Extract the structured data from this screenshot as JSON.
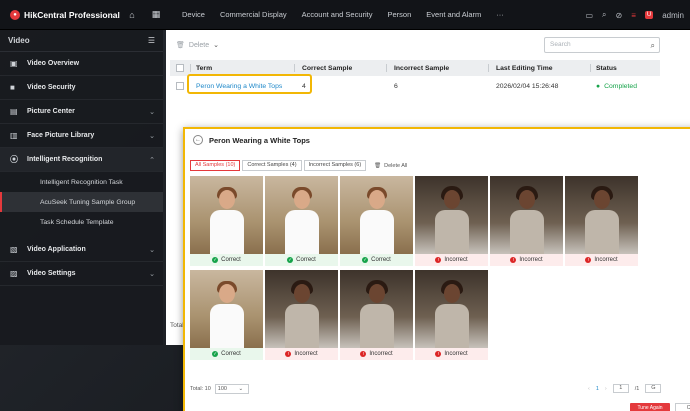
{
  "app": {
    "title": "HikCentral Professional",
    "user": "admin"
  },
  "menu": [
    "Device",
    "Commercial Display",
    "Account and Security",
    "Person",
    "Event and Alarm",
    "···"
  ],
  "sidebar": {
    "section": "Video",
    "items": [
      {
        "label": "Video Overview"
      },
      {
        "label": "Video Security"
      },
      {
        "label": "Picture Center"
      },
      {
        "label": "Face Picture Library"
      },
      {
        "label": "Intelligent Recognition"
      },
      {
        "label": "Video Application"
      },
      {
        "label": "Video Settings"
      }
    ],
    "subitems": [
      "Intelligent Recognition Task",
      "AcuSeek Tuning Sample Group",
      "Task Schedule Template"
    ]
  },
  "main": {
    "delete_label": "Delete",
    "search_placeholder": "Search",
    "columns": [
      "Term",
      "Correct Sample",
      "Incorrect Sample",
      "Last Editing Time",
      "Status"
    ],
    "row": {
      "term": "Peron Wearing a White Tops",
      "correct": "4",
      "incorrect": "6",
      "time": "2026/02/04 15:26:48",
      "status": "Completed"
    },
    "total_label": "Total"
  },
  "dialog": {
    "title": "Peron Wearing a White Tops",
    "tabs": [
      "All Samples (10)",
      "Correct Samples (4)",
      "Incorrect Samples (6)"
    ],
    "delete_all": "Delete All",
    "cards": [
      {
        "label": "Correct"
      },
      {
        "label": "Correct"
      },
      {
        "label": "Correct"
      },
      {
        "label": "Incorrect"
      },
      {
        "label": "Incorrect"
      },
      {
        "label": "Incorrect"
      },
      {
        "label": "Correct"
      },
      {
        "label": "Incorrect"
      },
      {
        "label": "Incorrect"
      },
      {
        "label": "Incorrect"
      }
    ],
    "total": "Total: 10",
    "page_size": "100",
    "page_current": "1",
    "page_input": "1",
    "page_total": "/1",
    "go": "G",
    "btn_tune": "Tune Again",
    "btn_cancel": "Ca"
  },
  "colors": {
    "accent": "#e4393c",
    "highlight": "#f2b705",
    "link": "#1e88c9",
    "success": "#16a34a"
  }
}
